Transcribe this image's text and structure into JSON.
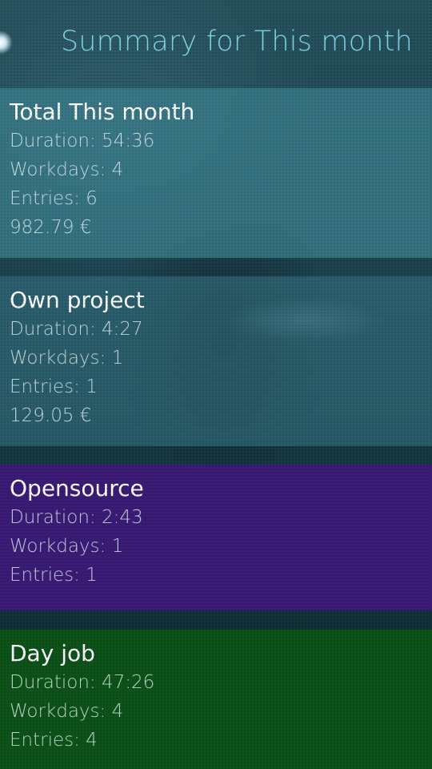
{
  "header": {
    "title": "Summary for This month"
  },
  "summaries": [
    {
      "title": "Total This month",
      "duration": "Duration: 54:36",
      "workdays": "Workdays: 4",
      "entries": "Entries: 6",
      "price": "982.79 €",
      "color": "#3e8291"
    },
    {
      "title": "Own project",
      "duration": "Duration: 4:27",
      "workdays": "Workdays: 1",
      "entries": "Entries: 1",
      "price": "129.05 €",
      "color": "#377382"
    },
    {
      "title": "Opensource",
      "duration": "Duration: 2:43",
      "workdays": "Workdays: 1",
      "entries": "Entries: 1",
      "color": "#3a1c76"
    },
    {
      "title": "Day job",
      "duration": "Duration: 47:26",
      "workdays": "Workdays: 4",
      "entries": "Entries: 4",
      "color": "#0d5319"
    }
  ]
}
